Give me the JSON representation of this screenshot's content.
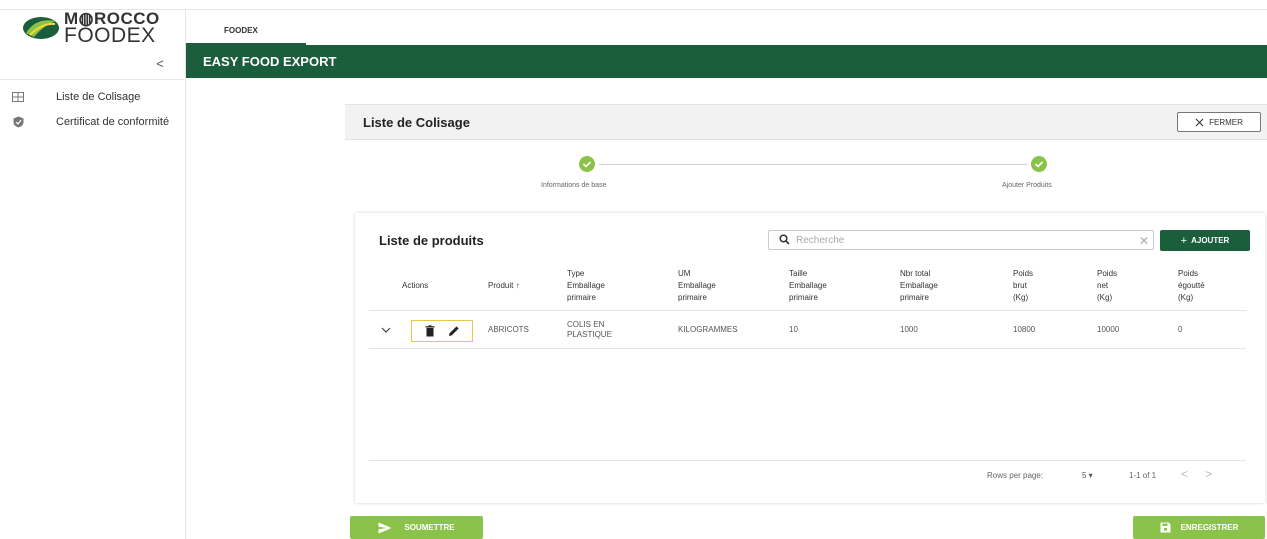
{
  "app": {
    "logo_line1": "M◍ROCCO",
    "logo_line2": "FOODEX",
    "tab": "FOODEX",
    "banner_title": "EASY FOOD EXPORT",
    "accent_color": "#1b5e3b",
    "success_color": "#8bc34a"
  },
  "sidebar": {
    "collapse_icon": "chevron-left-icon",
    "collapse_label": "<",
    "items": [
      {
        "label": "Liste de Colisage",
        "icon": "table-icon"
      },
      {
        "label": "Certificat de conformité",
        "icon": "shield-check-icon"
      }
    ]
  },
  "panel": {
    "title": "Liste de Colisage",
    "close_label": "FERMER"
  },
  "stepper": {
    "steps": [
      {
        "label": "Informations de base",
        "state": "completed"
      },
      {
        "label": "Ajouter Produits",
        "state": "completed"
      }
    ]
  },
  "products": {
    "title": "Liste de produits",
    "search_placeholder": "Recherche",
    "add_label": "AJOUTER",
    "columns": [
      "Actions",
      "Produit ↑",
      "Type\nEmballage\nprimaire",
      "UM\nEmballage\nprimaire",
      "Taille\nEmballage\nprimaire",
      "Nbr total\nEmballage\nprimaire",
      "Poids\nbrut\n(Kg)",
      "Poids\nnet\n(Kg)",
      "Poids\négoutté\n(Kg)"
    ],
    "rows": [
      {
        "produit": "ABRICOTS",
        "type_emballage": "COLIS EN PLASTIQUE",
        "um_emballage": "KILOGRAMMES",
        "taille_emballage": "10",
        "nbr_total": "1000",
        "poids_brut": "10800",
        "poids_net": "10000",
        "poids_egoutte": "0"
      }
    ],
    "footer": {
      "rows_per_page_label": "Rows per page:",
      "rows_per_page_value": "5 ▾",
      "range": "1-1 of 1",
      "prev": "<",
      "next": ">"
    }
  },
  "actions": {
    "submit_label": "SOUMETTRE",
    "save_label": "ENREGISTRER"
  }
}
